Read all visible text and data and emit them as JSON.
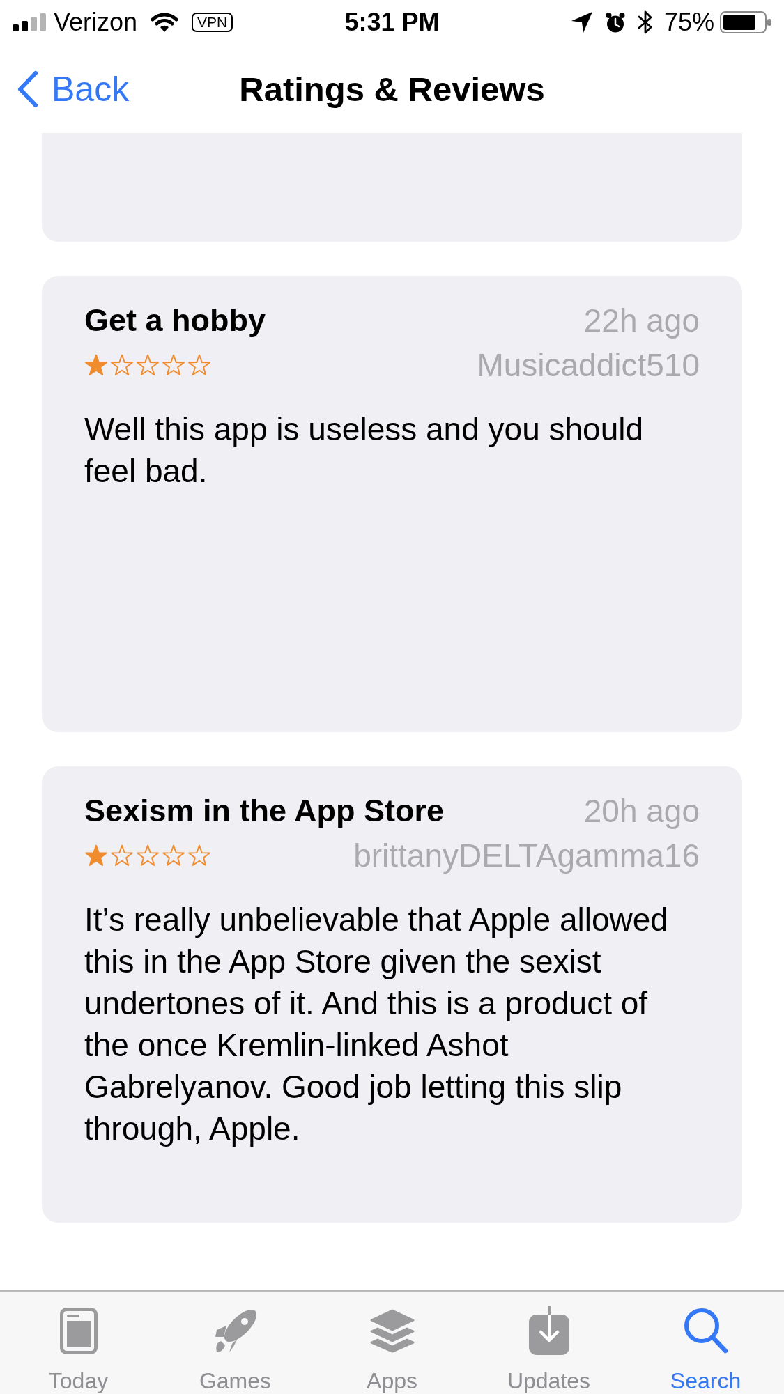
{
  "status_bar": {
    "carrier": "Verizon",
    "vpn": "VPN",
    "time": "5:31 PM",
    "battery": "75%"
  },
  "nav_bar": {
    "back": "Back",
    "title": "Ratings & Reviews"
  },
  "reviews": [
    {
      "title": "Get a hobby",
      "date": "22h ago",
      "stars": 1,
      "author": "Musicaddict510",
      "body": "Well this app is useless and you should feel bad."
    },
    {
      "title": "Sexism in the App Store",
      "date": "20h ago",
      "stars": 1,
      "author": "brittanyDELTAgamma16",
      "body": "It’s really unbelievable that Apple allowed this in the App Store given the sexist undertones of it. And this is a product of the once Kremlin-linked Ashot Gabrelyanov. Good job letting this slip through, Apple."
    }
  ],
  "tab_bar": [
    {
      "label": "Today",
      "selected": false
    },
    {
      "label": "Games",
      "selected": false
    },
    {
      "label": "Apps",
      "selected": false
    },
    {
      "label": "Updates",
      "selected": false
    },
    {
      "label": "Search",
      "selected": true
    }
  ]
}
